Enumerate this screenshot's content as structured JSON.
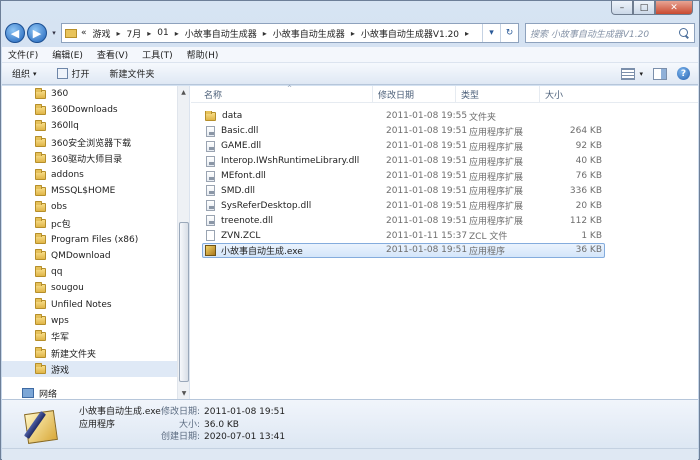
{
  "window": {
    "caption": {
      "minimize": "–",
      "maximize": "□",
      "close": "✕"
    }
  },
  "nav": {
    "back": "◀",
    "forward": "▶",
    "history": "▾",
    "overflow": "«",
    "breadcrumbs": [
      "游戏",
      "7月",
      "01",
      "小故事自动生成器",
      "小故事自动生成器",
      "小故事自动生成器V1.20"
    ],
    "address_dropdown": "▾",
    "refresh": "↻",
    "search_placeholder": "搜索 小故事自动生成器V1.20"
  },
  "menu": [
    "文件(F)",
    "编辑(E)",
    "查看(V)",
    "工具(T)",
    "帮助(H)"
  ],
  "toolbar": {
    "organize": "组织",
    "organize_drop": "▾",
    "open": "打开",
    "new_folder": "新建文件夹",
    "view_drop": "▾",
    "help": "?"
  },
  "nav_tree": [
    "360",
    "360Downloads",
    "360llq",
    "360安全浏览器下载",
    "360驱动大师目录",
    "addons",
    "MSSQL$HOME",
    "obs",
    "pc包",
    "Program Files (x86)",
    "QMDownload",
    "qq",
    "sougou",
    "Unfiled Notes",
    "wps",
    "华军",
    "新建文件夹",
    "游戏"
  ],
  "nav_tree_selected": "游戏",
  "nav_network": "网络",
  "scroll": {
    "up": "▲",
    "down": "▼"
  },
  "columns": {
    "name": "名称",
    "date": "修改日期",
    "type": "类型",
    "size": "大小",
    "sort": "^"
  },
  "files": [
    {
      "name": "data",
      "date": "2011-01-08 19:55",
      "type": "文件夹",
      "size": "",
      "icon": "folder-icon"
    },
    {
      "name": "Basic.dll",
      "date": "2011-01-08 19:51",
      "type": "应用程序扩展",
      "size": "264 KB",
      "icon": "dll-icon"
    },
    {
      "name": "GAME.dll",
      "date": "2011-01-08 19:51",
      "type": "应用程序扩展",
      "size": "92 KB",
      "icon": "dll-icon"
    },
    {
      "name": "Interop.IWshRuntimeLibrary.dll",
      "date": "2011-01-08 19:51",
      "type": "应用程序扩展",
      "size": "40 KB",
      "icon": "dll-icon"
    },
    {
      "name": "MEfont.dll",
      "date": "2011-01-08 19:51",
      "type": "应用程序扩展",
      "size": "76 KB",
      "icon": "dll-icon"
    },
    {
      "name": "SMD.dll",
      "date": "2011-01-08 19:51",
      "type": "应用程序扩展",
      "size": "336 KB",
      "icon": "dll-icon"
    },
    {
      "name": "SysReferDesktop.dll",
      "date": "2011-01-08 19:51",
      "type": "应用程序扩展",
      "size": "20 KB",
      "icon": "dll-icon"
    },
    {
      "name": "treenote.dll",
      "date": "2011-01-08 19:51",
      "type": "应用程序扩展",
      "size": "112 KB",
      "icon": "dll-icon"
    },
    {
      "name": "ZVN.ZCL",
      "date": "2011-01-11 15:37",
      "type": "ZCL 文件",
      "size": "1 KB",
      "icon": "document-icon"
    },
    {
      "name": "小故事自动生成.exe",
      "date": "2011-01-08 19:51",
      "type": "应用程序",
      "size": "36 KB",
      "icon": "exe-icon",
      "selected": true
    }
  ],
  "details": {
    "name": "小故事自动生成.exe",
    "kind": "应用程序",
    "labels": [
      "修改日期:",
      "大小:",
      "创建日期:"
    ],
    "values": [
      "2011-01-08 19:51",
      "36.0 KB",
      "2020-07-01 13:41"
    ]
  }
}
